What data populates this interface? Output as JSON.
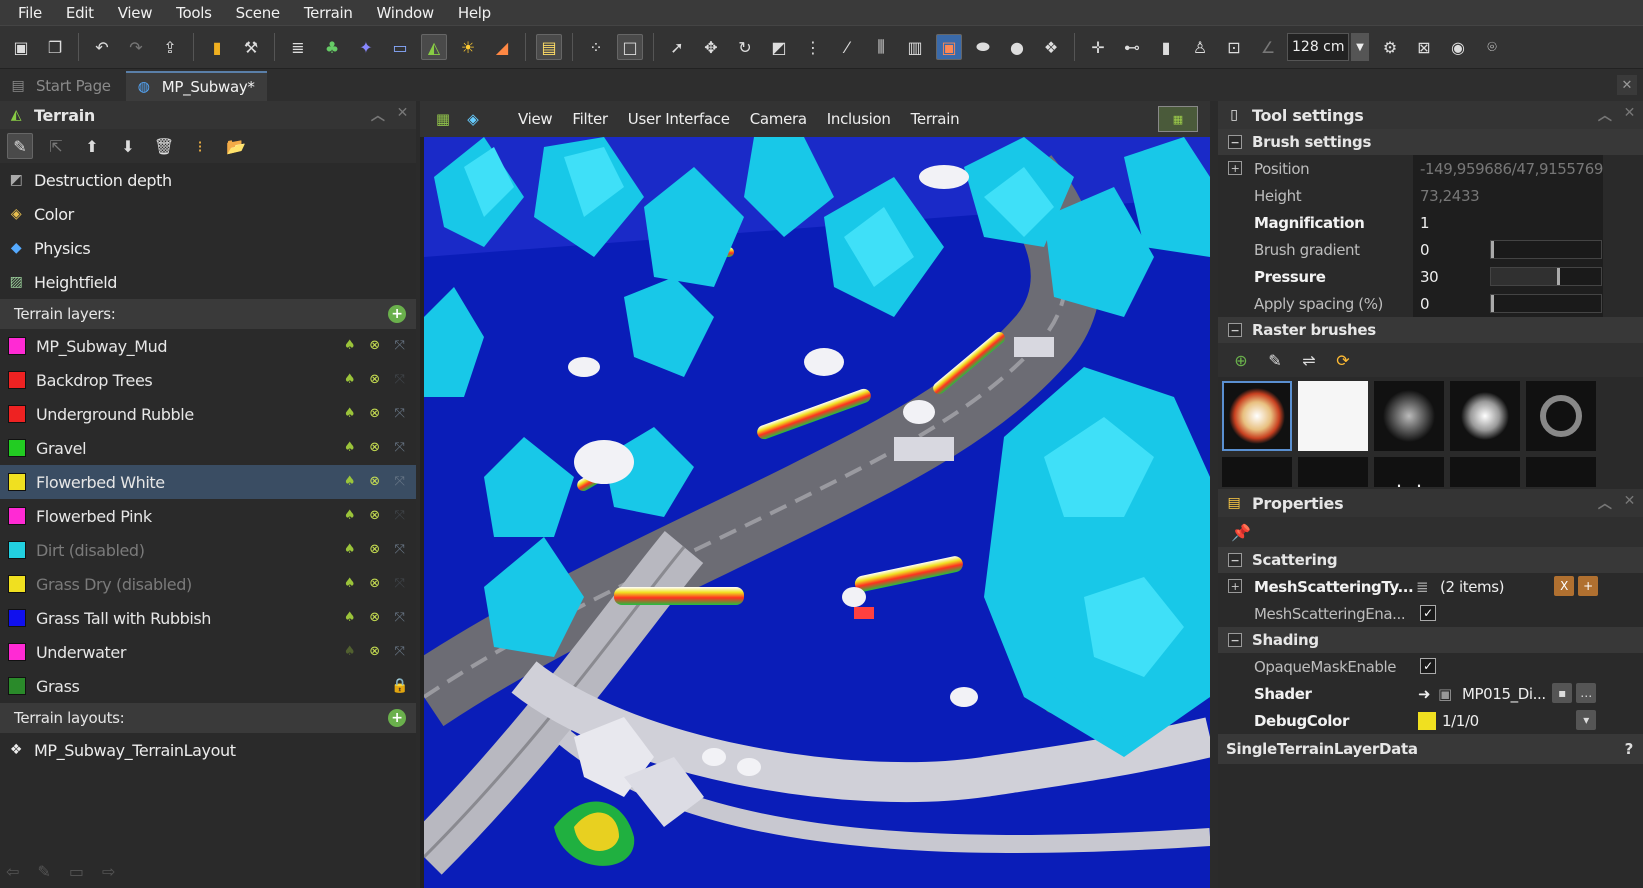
{
  "menu": [
    "File",
    "Edit",
    "View",
    "Tools",
    "Scene",
    "Terrain",
    "Window",
    "Help"
  ],
  "toolbar": {
    "unit_value": "128 cm"
  },
  "tabs": [
    {
      "label": "Start Page"
    },
    {
      "label": "MP_Subway*"
    }
  ],
  "terrain_panel": {
    "title": "Terrain",
    "items": [
      {
        "label": "Destruction depth",
        "icon": "destruction-icon"
      },
      {
        "label": "Color",
        "icon": "color-icon"
      },
      {
        "label": "Physics",
        "icon": "physics-icon"
      },
      {
        "label": "Heightfield",
        "icon": "heightfield-icon"
      }
    ],
    "layers_header": "Terrain layers:",
    "layers": [
      {
        "name": "MP_Subway_Mud",
        "color": "#ff2ad4"
      },
      {
        "name": "Backdrop Trees",
        "color": "#ee2222"
      },
      {
        "name": "Underground Rubble",
        "color": "#ee2222"
      },
      {
        "name": "Gravel",
        "color": "#22cc22"
      },
      {
        "name": "Flowerbed White",
        "color": "#f0e020"
      },
      {
        "name": "Flowerbed Pink",
        "color": "#ff2ad4"
      },
      {
        "name": "Dirt (disabled)",
        "color": "#22d0e0"
      },
      {
        "name": "Grass Dry (disabled)",
        "color": "#f0e020"
      },
      {
        "name": "Grass Tall with Rubbish",
        "color": "#1010ee"
      },
      {
        "name": "Underwater",
        "color": "#ff2ad4"
      },
      {
        "name": "Grass",
        "color": "#2a8a2a"
      }
    ],
    "layouts_header": "Terrain layouts:",
    "layout_item": "MP_Subway_TerrainLayout"
  },
  "viewport": {
    "menu": [
      "View",
      "Filter",
      "User Interface",
      "Camera",
      "Inclusion",
      "Terrain"
    ]
  },
  "tool_settings": {
    "title": "Tool settings",
    "brush_header": "Brush settings",
    "rows": [
      {
        "label": "Position",
        "value": "-149,959686/47,9155769",
        "bold": false,
        "dim": true
      },
      {
        "label": "Height",
        "value": "73,2433",
        "bold": false,
        "dim": true
      },
      {
        "label": "Magnification",
        "value": "1",
        "bold": true,
        "dim": false
      },
      {
        "label": "Brush gradient",
        "value": "0",
        "bold": false,
        "dim": false,
        "slider": 0.0
      },
      {
        "label": "Pressure",
        "value": "30",
        "bold": true,
        "dim": false,
        "slider": 0.6
      },
      {
        "label": "Apply spacing (%)",
        "value": "0",
        "bold": false,
        "dim": false,
        "slider": 0.0
      }
    ],
    "raster_header": "Raster brushes"
  },
  "properties": {
    "title": "Properties",
    "scattering_header": "Scattering",
    "mesh_type_label": "MeshScatteringTy...",
    "mesh_type_value": "(2 items)",
    "mesh_enable_label": "MeshScatteringEna...",
    "shading_header": "Shading",
    "opaque_label": "OpaqueMaskEnable",
    "shader_label": "Shader",
    "shader_value": "MP015_Di...",
    "debug_label": "DebugColor",
    "debug_value": "1/1/0",
    "debug_color": "#f0e020",
    "footer": "SingleTerrainLayerData",
    "help": "?"
  }
}
